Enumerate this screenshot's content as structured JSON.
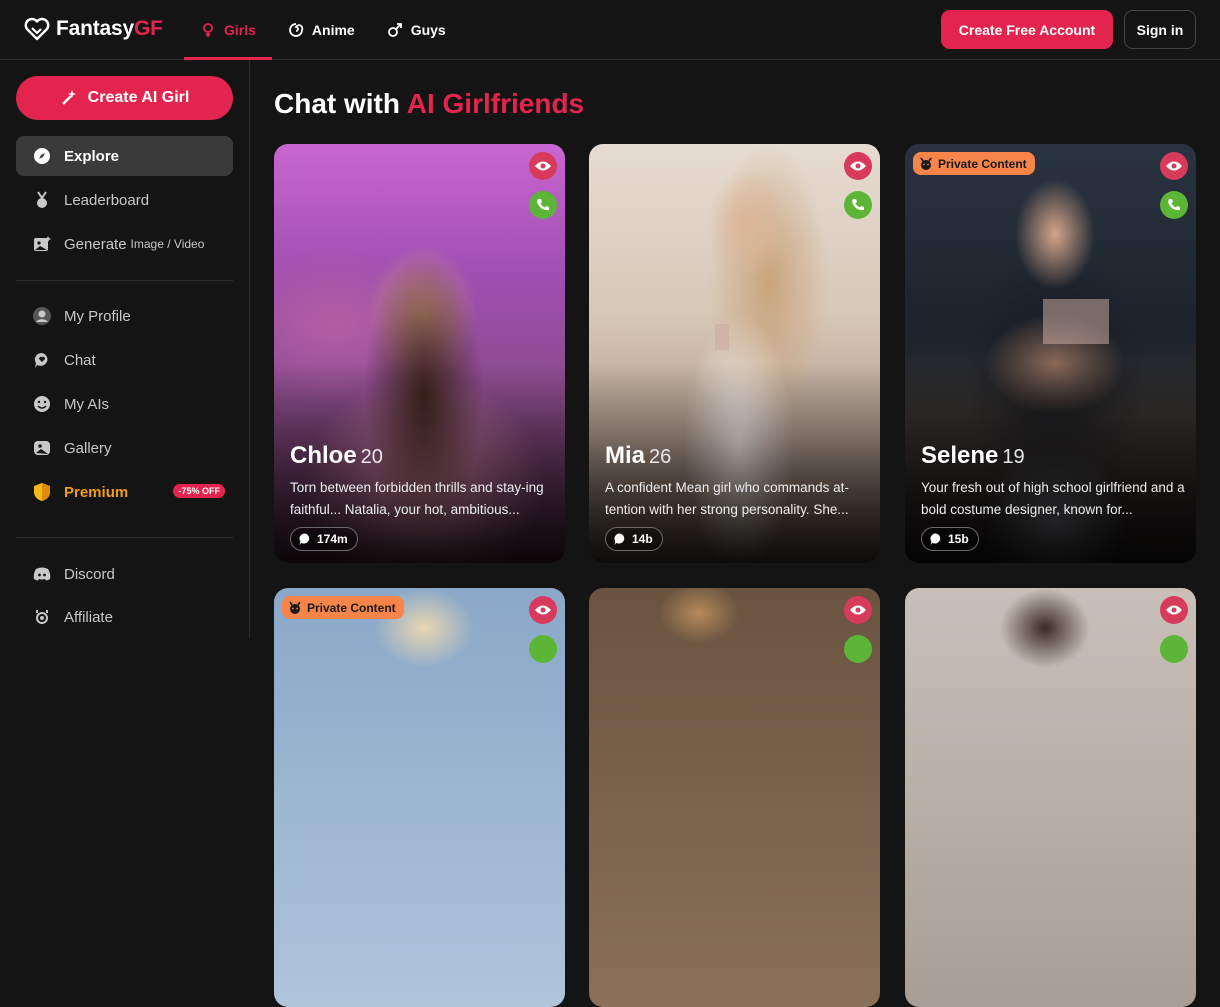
{
  "header": {
    "logo_main": "Fantasy",
    "logo_accent": "GF",
    "tabs": [
      {
        "label": "Girls",
        "icon": "female-icon",
        "active": true
      },
      {
        "label": "Anime",
        "icon": "anime-icon",
        "active": false
      },
      {
        "label": "Guys",
        "icon": "male-icon",
        "active": false
      }
    ],
    "create_account_label": "Create Free Account",
    "signin_label": "Sign in"
  },
  "sidebar": {
    "create_ai_label": "Create AI Girl",
    "explore": "Explore",
    "leaderboard": "Leaderboard",
    "generate": "Generate",
    "generate_sub": "Image / Video",
    "my_profile": "My Profile",
    "chat": "Chat",
    "my_ais": "My AIs",
    "gallery": "Gallery",
    "premium": "Premium",
    "premium_badge": "-75% OFF",
    "discord": "Discord",
    "affiliate": "Affiliate"
  },
  "main": {
    "title_plain": "Chat with",
    "title_accent": "AI Girlfriends",
    "private_label": "Private Content",
    "cards": [
      {
        "name": "Chloe",
        "age": "20",
        "desc": "Torn between forbidden thrills and stay-ing faithful... Natalia, your hot, ambitious...",
        "stat": "174m",
        "private": false
      },
      {
        "name": "Mia",
        "age": "26",
        "desc": "A confident Mean girl who commands at-tention with her strong personality. She...",
        "stat": "14b",
        "private": false
      },
      {
        "name": "Selene",
        "age": "19",
        "desc": "Your fresh out of high school girlfriend and a bold costume designer, known for...",
        "stat": "15b",
        "private": true
      }
    ]
  },
  "colors": {
    "accent": "#e3244f",
    "call": "#5cb536",
    "badge": "#f7854a",
    "premium": "#f39c12"
  }
}
